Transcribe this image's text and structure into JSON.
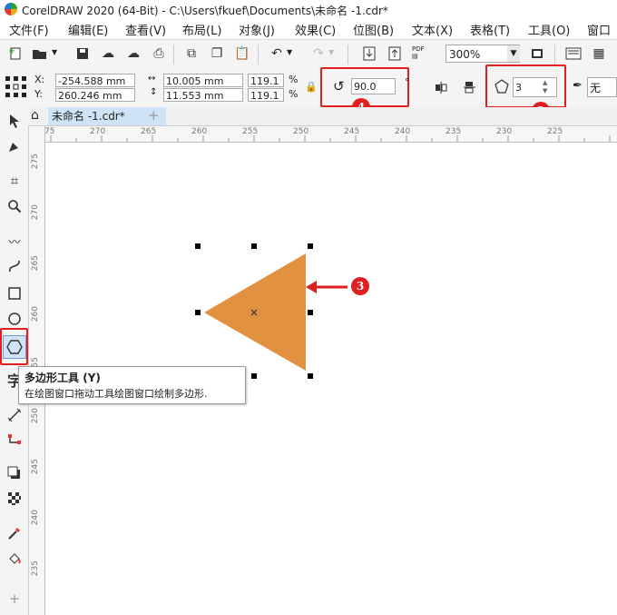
{
  "window": {
    "title": "CorelDRAW 2020 (64-Bit) - C:\\Users\\fkuef\\Documents\\未命名 -1.cdr*"
  },
  "menu": [
    {
      "label": "文件(F)"
    },
    {
      "label": "编辑(E)"
    },
    {
      "label": "查看(V)"
    },
    {
      "label": "布局(L)"
    },
    {
      "label": "对象(J)"
    },
    {
      "label": "效果(C)"
    },
    {
      "label": "位图(B)"
    },
    {
      "label": "文本(X)"
    },
    {
      "label": "表格(T)"
    },
    {
      "label": "工具(O)"
    },
    {
      "label": "窗口"
    }
  ],
  "toolbar": {
    "zoom": "300%",
    "pdf_label": "PDF"
  },
  "properties": {
    "x_label": "X:",
    "y_label": "Y:",
    "x": "-254.588 mm",
    "y": "260.246 mm",
    "width": "10.005 mm",
    "height": "11.553 mm",
    "scale_w": "119.1",
    "scale_h": "119.1",
    "percent": "%",
    "rotation": "90.0",
    "degree_symbol": "°",
    "polygon_points": "3",
    "outline": "无"
  },
  "document": {
    "tab_label": "未命名 -1.cdr*",
    "add_tab": "+"
  },
  "rulers": {
    "horizontal": [
      "75",
      "270",
      "265",
      "260",
      "255",
      "250",
      "245",
      "240",
      "235",
      "230",
      "225"
    ],
    "vertical": [
      "275",
      "270",
      "265",
      "260",
      "255",
      "250",
      "245",
      "240",
      "235"
    ]
  },
  "shape": {
    "type": "triangle",
    "fill": "#E29140",
    "points": 3
  },
  "tooltip": {
    "title": "多边形工具",
    "shortcut": "(Y)",
    "description": "在绘图窗口拖动工具绘图窗口绘制多边形."
  },
  "annotations": [
    {
      "number": "1"
    },
    {
      "number": "2"
    },
    {
      "number": "3"
    },
    {
      "number": "4"
    }
  ],
  "colors": {
    "highlight_red": "#E02020",
    "tab_blue": "#CFE3F7",
    "triangle": "#E29140"
  }
}
